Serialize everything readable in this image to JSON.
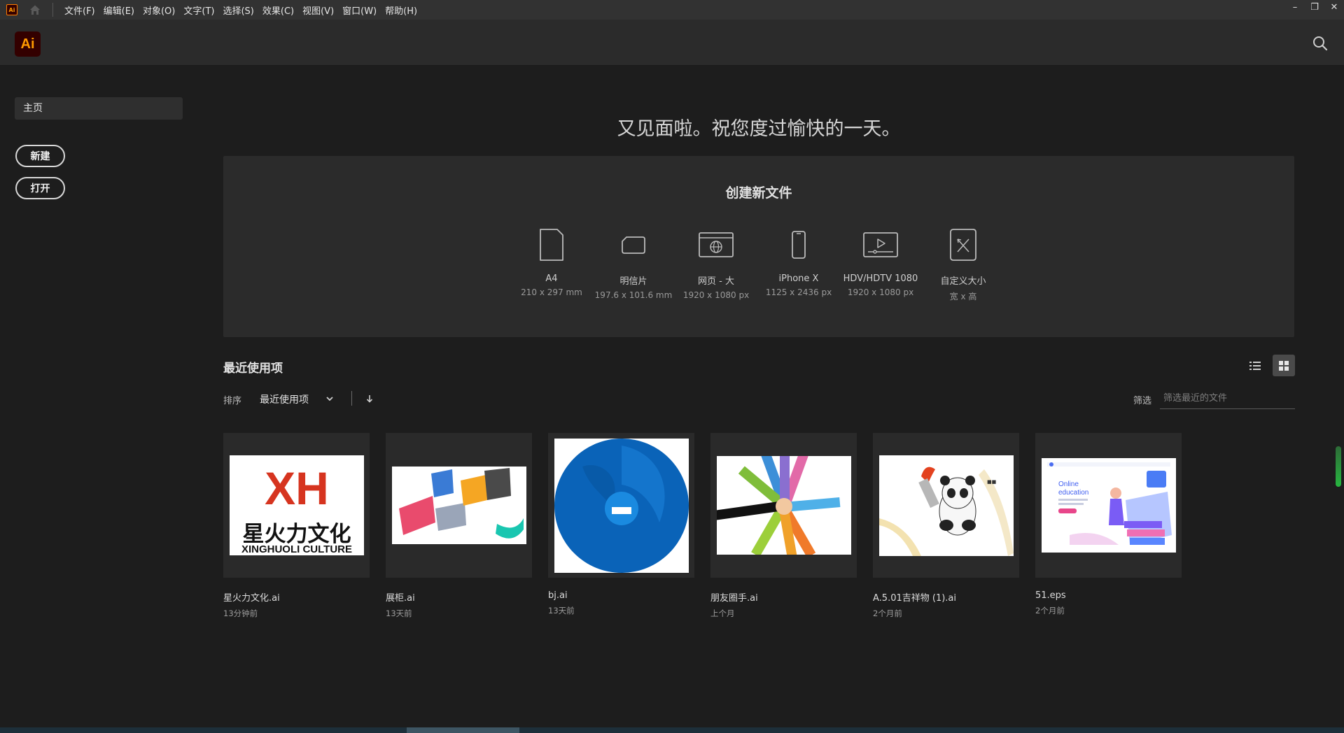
{
  "menubar": {
    "app_badge": "Ai",
    "items": [
      "文件(F)",
      "编辑(E)",
      "对象(O)",
      "文字(T)",
      "选择(S)",
      "效果(C)",
      "视图(V)",
      "窗口(W)",
      "帮助(H)"
    ]
  },
  "window_controls": {
    "minimize": "–",
    "restore": "❐",
    "close": "✕"
  },
  "appbar": {
    "logo": "Ai"
  },
  "sidebar": {
    "home": "主页",
    "new_button": "新建",
    "open_button": "打开"
  },
  "greeting": "又见面啦。祝您度过愉快的一天。",
  "create": {
    "title": "创建新文件",
    "presets": [
      {
        "name": "A4",
        "size": "210 x 297 mm",
        "icon": "document-icon"
      },
      {
        "name": "明信片",
        "size": "197.6 x 101.6 mm",
        "icon": "postcard-icon"
      },
      {
        "name": "网页 - 大",
        "size": "1920 x 1080 px",
        "icon": "web-icon"
      },
      {
        "name": "iPhone X",
        "size": "1125 x 2436 px",
        "icon": "phone-icon"
      },
      {
        "name": "HDV/HDTV 1080",
        "size": "1920 x 1080 px",
        "icon": "video-icon"
      },
      {
        "name": "自定义大小",
        "size": "宽 x 高",
        "icon": "custom-size-icon"
      }
    ]
  },
  "recent": {
    "title": "最近使用项",
    "sort_label": "排序",
    "sort_value": "最近使用项",
    "filter_label": "筛选",
    "filter_placeholder": "筛选最近的文件",
    "files": [
      {
        "name": "星火力文化.ai",
        "time": "13分钟前"
      },
      {
        "name": "展柜.ai",
        "time": "13天前"
      },
      {
        "name": "bj.ai",
        "time": "13天前"
      },
      {
        "name": "朋友圈手.ai",
        "time": "上个月"
      },
      {
        "name": "A.5.01吉祥物 (1).ai",
        "time": "2个月前"
      },
      {
        "name": "51.eps",
        "time": "2个月前"
      }
    ],
    "thumb_texts": {
      "logo_main": "XH",
      "logo_cn": "星火力文化",
      "logo_en": "XINGHUOLI CULTURE",
      "edu_line1": "Online",
      "edu_line2": "education"
    }
  },
  "colors": {
    "accent_orange": "#ff9a00",
    "logo_bg": "#330000",
    "bg": "#1d1d1d",
    "panel": "#2b2b2b"
  }
}
